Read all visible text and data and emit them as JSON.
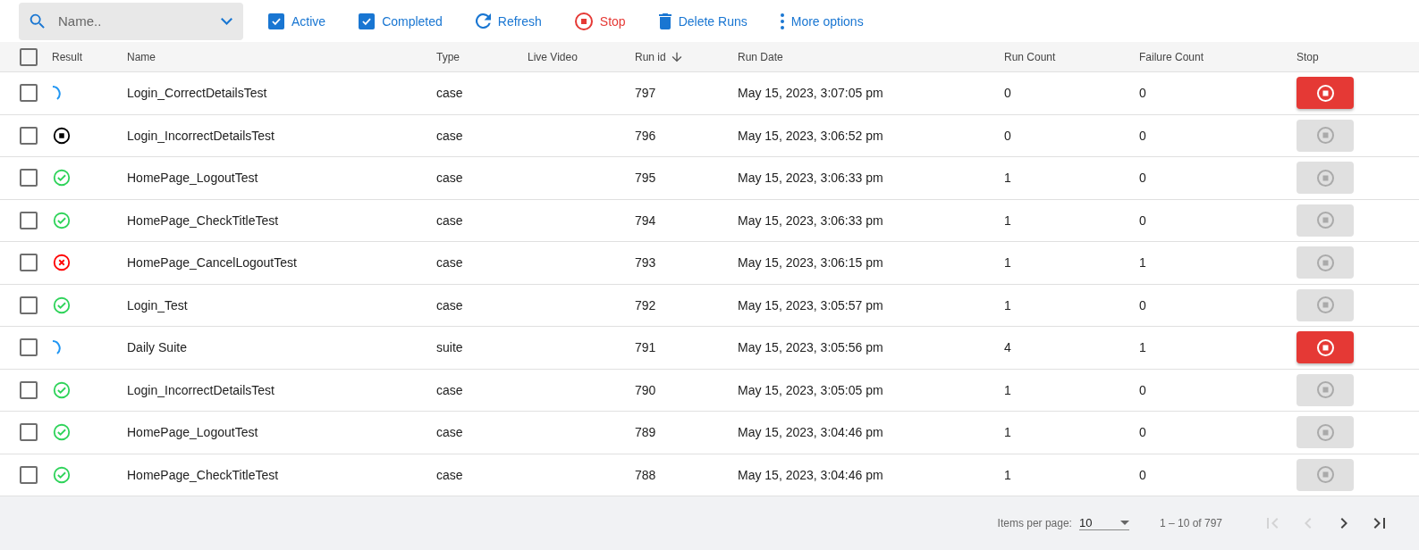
{
  "toolbar": {
    "search": {
      "placeholder": "Name.."
    },
    "filters": [
      {
        "label": "Active",
        "checked": true
      },
      {
        "label": "Completed",
        "checked": true
      }
    ],
    "actions": [
      {
        "kind": "refresh",
        "label": "Refresh"
      },
      {
        "kind": "stop",
        "label": "Stop"
      },
      {
        "kind": "delete",
        "label": "Delete Runs"
      },
      {
        "kind": "more",
        "label": "More options"
      }
    ]
  },
  "table": {
    "select_all_checked": false,
    "columns": [
      {
        "label": "Result"
      },
      {
        "label": "Name"
      },
      {
        "label": "Type"
      },
      {
        "label": "Live Video"
      },
      {
        "label": "Run id",
        "sorted": true
      },
      {
        "label": "Run Date"
      },
      {
        "label": "Run Count"
      },
      {
        "label": "Failure Count"
      },
      {
        "label": "Stop"
      }
    ],
    "rows": [
      {
        "checked": false,
        "kind": "running",
        "name": "Login_CorrectDetailsTest",
        "type": "case",
        "run_id": "797",
        "run_date": "May 15, 2023, 3:07:05 pm",
        "run_count": "0",
        "failure_count": "0",
        "stop_disabled": false
      },
      {
        "checked": false,
        "kind": "stopped",
        "name": "Login_IncorrectDetailsTest",
        "type": "case",
        "run_id": "796",
        "run_date": "May 15, 2023, 3:06:52 pm",
        "run_count": "0",
        "failure_count": "0",
        "stop_disabled": true
      },
      {
        "checked": false,
        "kind": "passed",
        "name": "HomePage_LogoutTest",
        "type": "case",
        "run_id": "795",
        "run_date": "May 15, 2023, 3:06:33 pm",
        "run_count": "1",
        "failure_count": "0",
        "stop_disabled": true
      },
      {
        "checked": false,
        "kind": "passed",
        "name": "HomePage_CheckTitleTest",
        "type": "case",
        "run_id": "794",
        "run_date": "May 15, 2023, 3:06:33 pm",
        "run_count": "1",
        "failure_count": "0",
        "stop_disabled": true
      },
      {
        "checked": false,
        "kind": "failed",
        "name": "HomePage_CancelLogoutTest",
        "type": "case",
        "run_id": "793",
        "run_date": "May 15, 2023, 3:06:15 pm",
        "run_count": "1",
        "failure_count": "1",
        "stop_disabled": true
      },
      {
        "checked": false,
        "kind": "passed",
        "name": "Login_Test",
        "type": "case",
        "run_id": "792",
        "run_date": "May 15, 2023, 3:05:57 pm",
        "run_count": "1",
        "failure_count": "0",
        "stop_disabled": true
      },
      {
        "checked": false,
        "kind": "running",
        "name": "Daily Suite",
        "type": "suite",
        "run_id": "791",
        "run_date": "May 15, 2023, 3:05:56 pm",
        "run_count": "4",
        "failure_count": "1",
        "stop_disabled": false
      },
      {
        "checked": false,
        "kind": "passed",
        "name": "Login_IncorrectDetailsTest",
        "type": "case",
        "run_id": "790",
        "run_date": "May 15, 2023, 3:05:05 pm",
        "run_count": "1",
        "failure_count": "0",
        "stop_disabled": true
      },
      {
        "checked": false,
        "kind": "passed",
        "name": "HomePage_LogoutTest",
        "type": "case",
        "run_id": "789",
        "run_date": "May 15, 2023, 3:04:46 pm",
        "run_count": "1",
        "failure_count": "0",
        "stop_disabled": true
      },
      {
        "checked": false,
        "kind": "passed",
        "name": "HomePage_CheckTitleTest",
        "type": "case",
        "run_id": "788",
        "run_date": "May 15, 2023, 3:04:46 pm",
        "run_count": "1",
        "failure_count": "0",
        "stop_disabled": true
      }
    ]
  },
  "paginator": {
    "label": "Items per page:",
    "page_size": "10",
    "range": "1 – 10 of 797",
    "buttons": [
      {
        "kind": "first",
        "disabled": true
      },
      {
        "kind": "previous",
        "disabled": true
      },
      {
        "kind": "next",
        "disabled": false
      },
      {
        "kind": "last",
        "disabled": false
      }
    ]
  }
}
